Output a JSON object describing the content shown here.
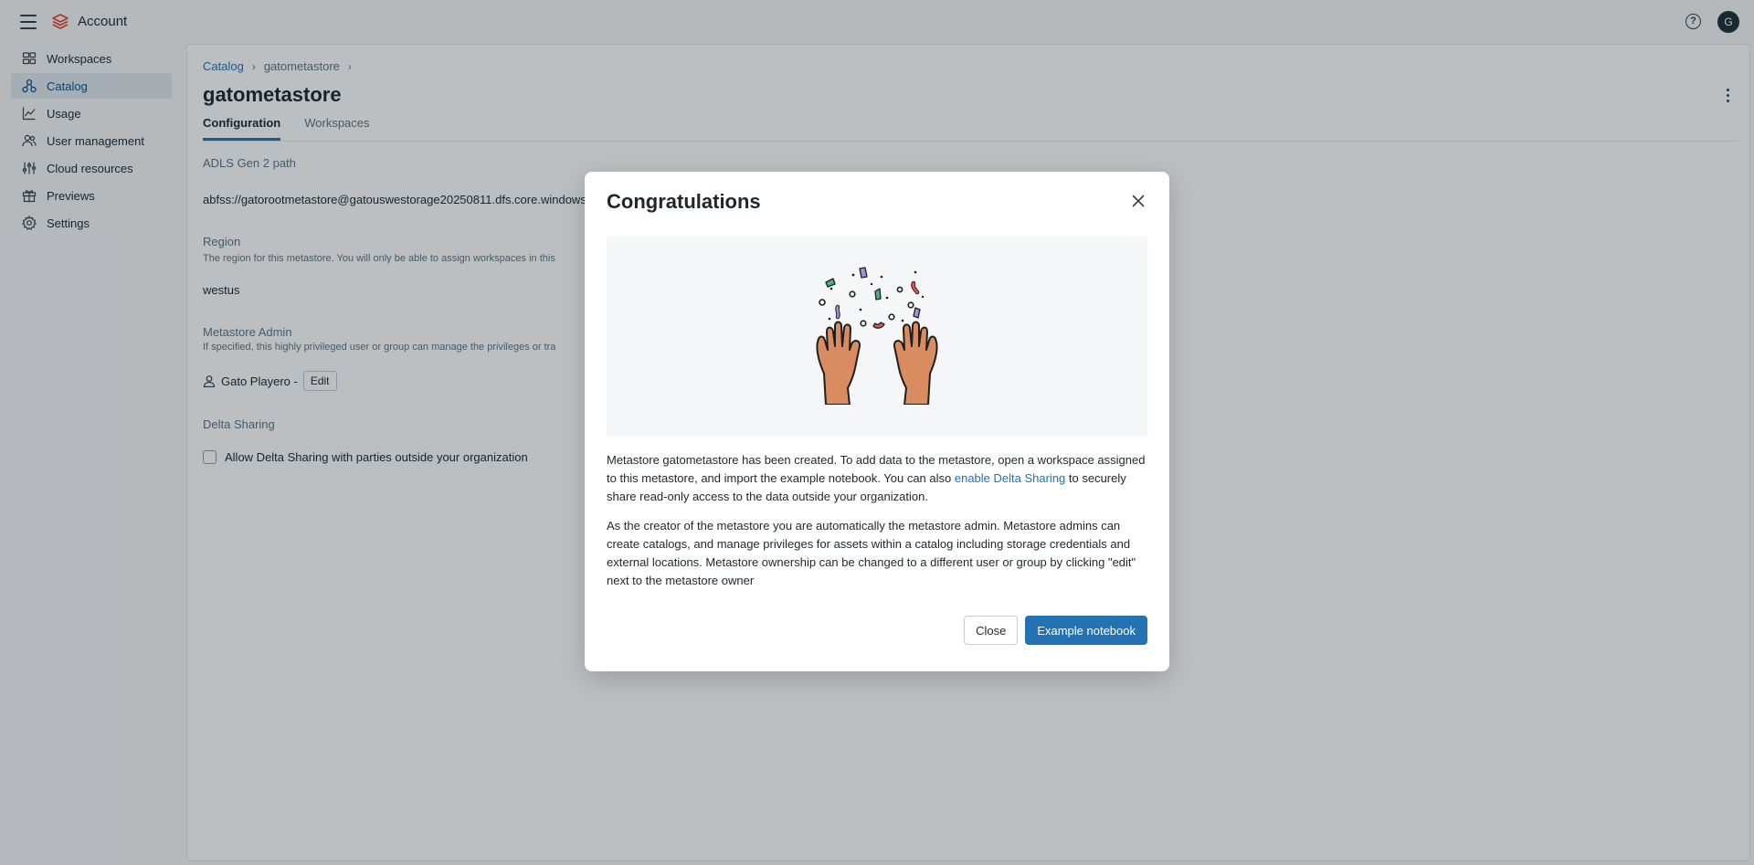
{
  "header": {
    "app_name": "Account",
    "avatar_initial": "G",
    "help_glyph": "?",
    "brand_color": "#e3412d"
  },
  "sidebar": {
    "items": [
      {
        "label": "Workspaces",
        "icon": "workspaces-icon"
      },
      {
        "label": "Catalog",
        "icon": "catalog-icon",
        "active": true
      },
      {
        "label": "Usage",
        "icon": "usage-chart-icon"
      },
      {
        "label": "User management",
        "icon": "users-icon"
      },
      {
        "label": "Cloud resources",
        "icon": "cloud-resources-icon"
      },
      {
        "label": "Previews",
        "icon": "gift-icon"
      },
      {
        "label": "Settings",
        "icon": "gear-icon"
      }
    ]
  },
  "breadcrumb": {
    "items": [
      "Catalog",
      "gatometastore"
    ],
    "separator": "›"
  },
  "page": {
    "title": "gatometastore",
    "tabs": [
      {
        "label": "Configuration",
        "active": true
      },
      {
        "label": "Workspaces",
        "active": false
      }
    ]
  },
  "config": {
    "adls_label": "ADLS Gen 2 path",
    "adls_value": "abfss://gatorootmetastore@gatouswestorage20250811.dfs.core.windows",
    "region_label": "Region",
    "region_desc": "The region for this metastore. You will only be able to assign workspaces in this",
    "region_value": "westus",
    "admin_label": "Metastore Admin",
    "admin_desc": "If specified, this highly privileged user or group can manage the privileges or tra",
    "admin_value": "Gato Playero -",
    "edit_label": "Edit",
    "delta_label": "Delta Sharing",
    "delta_checkbox_label": "Allow Delta Sharing with parties outside your organization"
  },
  "modal": {
    "title": "Congratulations",
    "illustration_icon": "celebration-hands-icon",
    "paragraph1_before": "Metastore gatometastore has been created. To add data to the metastore, open a workspace assigned to this metastore, and import the example notebook. You can also ",
    "paragraph1_link": "enable Delta Sharing",
    "paragraph1_after": " to securely share read-only access to the data outside your organization.",
    "paragraph2": "As the creator of the metastore you are automatically the metastore admin. Metastore admins can create catalogs, and manage privileges for assets within a catalog including storage credentials and external locations. Metastore ownership can be changed to a different user or group by clicking \"edit\" next to the metastore owner",
    "close_label": "Close",
    "primary_label": "Example notebook",
    "accent_color": "#2272b4"
  }
}
